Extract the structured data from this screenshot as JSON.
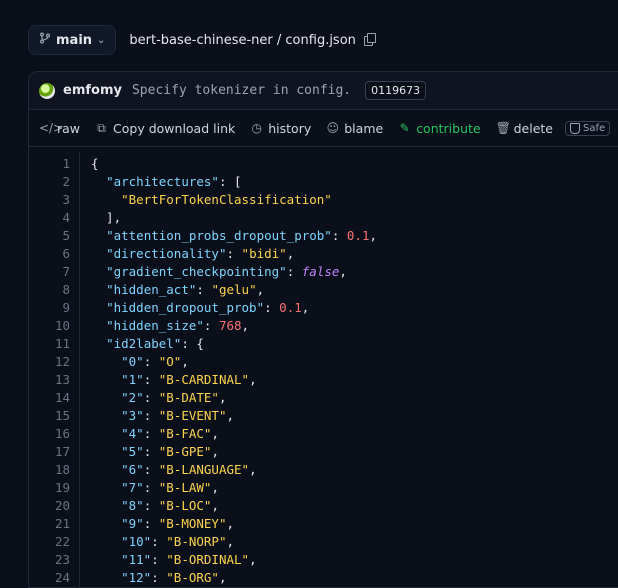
{
  "header": {
    "branch": "main",
    "file_path": "bert-base-chinese-ner / config.json"
  },
  "commit": {
    "author": "emfomy",
    "message": "Specify tokenizer in config.",
    "hash": "0119673"
  },
  "toolbar": {
    "raw": "raw",
    "copy_link": "Copy download link",
    "history": "history",
    "blame": "blame",
    "contribute": "contribute",
    "delete": "delete",
    "safe": "Safe"
  },
  "colors": {
    "background": "#0b0f19",
    "key": "#7dd3fc",
    "string": "#fcd34d",
    "number": "#f87171",
    "boolean": "#c084fc",
    "contribute": "#22c55e"
  },
  "code_lines": [
    [
      {
        "t": "p",
        "v": "{"
      }
    ],
    [
      {
        "t": "p",
        "v": "  "
      },
      {
        "t": "k",
        "v": "\"architectures\""
      },
      {
        "t": "p",
        "v": ": ["
      }
    ],
    [
      {
        "t": "p",
        "v": "    "
      },
      {
        "t": "s",
        "v": "\"BertForTokenClassification\""
      }
    ],
    [
      {
        "t": "p",
        "v": "  ],"
      }
    ],
    [
      {
        "t": "p",
        "v": "  "
      },
      {
        "t": "k",
        "v": "\"attention_probs_dropout_prob\""
      },
      {
        "t": "p",
        "v": ": "
      },
      {
        "t": "n",
        "v": "0.1"
      },
      {
        "t": "p",
        "v": ","
      }
    ],
    [
      {
        "t": "p",
        "v": "  "
      },
      {
        "t": "k",
        "v": "\"directionality\""
      },
      {
        "t": "p",
        "v": ": "
      },
      {
        "t": "s",
        "v": "\"bidi\""
      },
      {
        "t": "p",
        "v": ","
      }
    ],
    [
      {
        "t": "p",
        "v": "  "
      },
      {
        "t": "k",
        "v": "\"gradient_checkpointing\""
      },
      {
        "t": "p",
        "v": ": "
      },
      {
        "t": "b",
        "v": "false"
      },
      {
        "t": "p",
        "v": ","
      }
    ],
    [
      {
        "t": "p",
        "v": "  "
      },
      {
        "t": "k",
        "v": "\"hidden_act\""
      },
      {
        "t": "p",
        "v": ": "
      },
      {
        "t": "s",
        "v": "\"gelu\""
      },
      {
        "t": "p",
        "v": ","
      }
    ],
    [
      {
        "t": "p",
        "v": "  "
      },
      {
        "t": "k",
        "v": "\"hidden_dropout_prob\""
      },
      {
        "t": "p",
        "v": ": "
      },
      {
        "t": "n",
        "v": "0.1"
      },
      {
        "t": "p",
        "v": ","
      }
    ],
    [
      {
        "t": "p",
        "v": "  "
      },
      {
        "t": "k",
        "v": "\"hidden_size\""
      },
      {
        "t": "p",
        "v": ": "
      },
      {
        "t": "n",
        "v": "768"
      },
      {
        "t": "p",
        "v": ","
      }
    ],
    [
      {
        "t": "p",
        "v": "  "
      },
      {
        "t": "k",
        "v": "\"id2label\""
      },
      {
        "t": "p",
        "v": ": {"
      }
    ],
    [
      {
        "t": "p",
        "v": "    "
      },
      {
        "t": "k",
        "v": "\"0\""
      },
      {
        "t": "p",
        "v": ": "
      },
      {
        "t": "s",
        "v": "\"O\""
      },
      {
        "t": "p",
        "v": ","
      }
    ],
    [
      {
        "t": "p",
        "v": "    "
      },
      {
        "t": "k",
        "v": "\"1\""
      },
      {
        "t": "p",
        "v": ": "
      },
      {
        "t": "s",
        "v": "\"B-CARDINAL\""
      },
      {
        "t": "p",
        "v": ","
      }
    ],
    [
      {
        "t": "p",
        "v": "    "
      },
      {
        "t": "k",
        "v": "\"2\""
      },
      {
        "t": "p",
        "v": ": "
      },
      {
        "t": "s",
        "v": "\"B-DATE\""
      },
      {
        "t": "p",
        "v": ","
      }
    ],
    [
      {
        "t": "p",
        "v": "    "
      },
      {
        "t": "k",
        "v": "\"3\""
      },
      {
        "t": "p",
        "v": ": "
      },
      {
        "t": "s",
        "v": "\"B-EVENT\""
      },
      {
        "t": "p",
        "v": ","
      }
    ],
    [
      {
        "t": "p",
        "v": "    "
      },
      {
        "t": "k",
        "v": "\"4\""
      },
      {
        "t": "p",
        "v": ": "
      },
      {
        "t": "s",
        "v": "\"B-FAC\""
      },
      {
        "t": "p",
        "v": ","
      }
    ],
    [
      {
        "t": "p",
        "v": "    "
      },
      {
        "t": "k",
        "v": "\"5\""
      },
      {
        "t": "p",
        "v": ": "
      },
      {
        "t": "s",
        "v": "\"B-GPE\""
      },
      {
        "t": "p",
        "v": ","
      }
    ],
    [
      {
        "t": "p",
        "v": "    "
      },
      {
        "t": "k",
        "v": "\"6\""
      },
      {
        "t": "p",
        "v": ": "
      },
      {
        "t": "s",
        "v": "\"B-LANGUAGE\""
      },
      {
        "t": "p",
        "v": ","
      }
    ],
    [
      {
        "t": "p",
        "v": "    "
      },
      {
        "t": "k",
        "v": "\"7\""
      },
      {
        "t": "p",
        "v": ": "
      },
      {
        "t": "s",
        "v": "\"B-LAW\""
      },
      {
        "t": "p",
        "v": ","
      }
    ],
    [
      {
        "t": "p",
        "v": "    "
      },
      {
        "t": "k",
        "v": "\"8\""
      },
      {
        "t": "p",
        "v": ": "
      },
      {
        "t": "s",
        "v": "\"B-LOC\""
      },
      {
        "t": "p",
        "v": ","
      }
    ],
    [
      {
        "t": "p",
        "v": "    "
      },
      {
        "t": "k",
        "v": "\"9\""
      },
      {
        "t": "p",
        "v": ": "
      },
      {
        "t": "s",
        "v": "\"B-MONEY\""
      },
      {
        "t": "p",
        "v": ","
      }
    ],
    [
      {
        "t": "p",
        "v": "    "
      },
      {
        "t": "k",
        "v": "\"10\""
      },
      {
        "t": "p",
        "v": ": "
      },
      {
        "t": "s",
        "v": "\"B-NORP\""
      },
      {
        "t": "p",
        "v": ","
      }
    ],
    [
      {
        "t": "p",
        "v": "    "
      },
      {
        "t": "k",
        "v": "\"11\""
      },
      {
        "t": "p",
        "v": ": "
      },
      {
        "t": "s",
        "v": "\"B-ORDINAL\""
      },
      {
        "t": "p",
        "v": ","
      }
    ],
    [
      {
        "t": "p",
        "v": "    "
      },
      {
        "t": "k",
        "v": "\"12\""
      },
      {
        "t": "p",
        "v": ": "
      },
      {
        "t": "s",
        "v": "\"B-ORG\""
      },
      {
        "t": "p",
        "v": ","
      }
    ]
  ]
}
